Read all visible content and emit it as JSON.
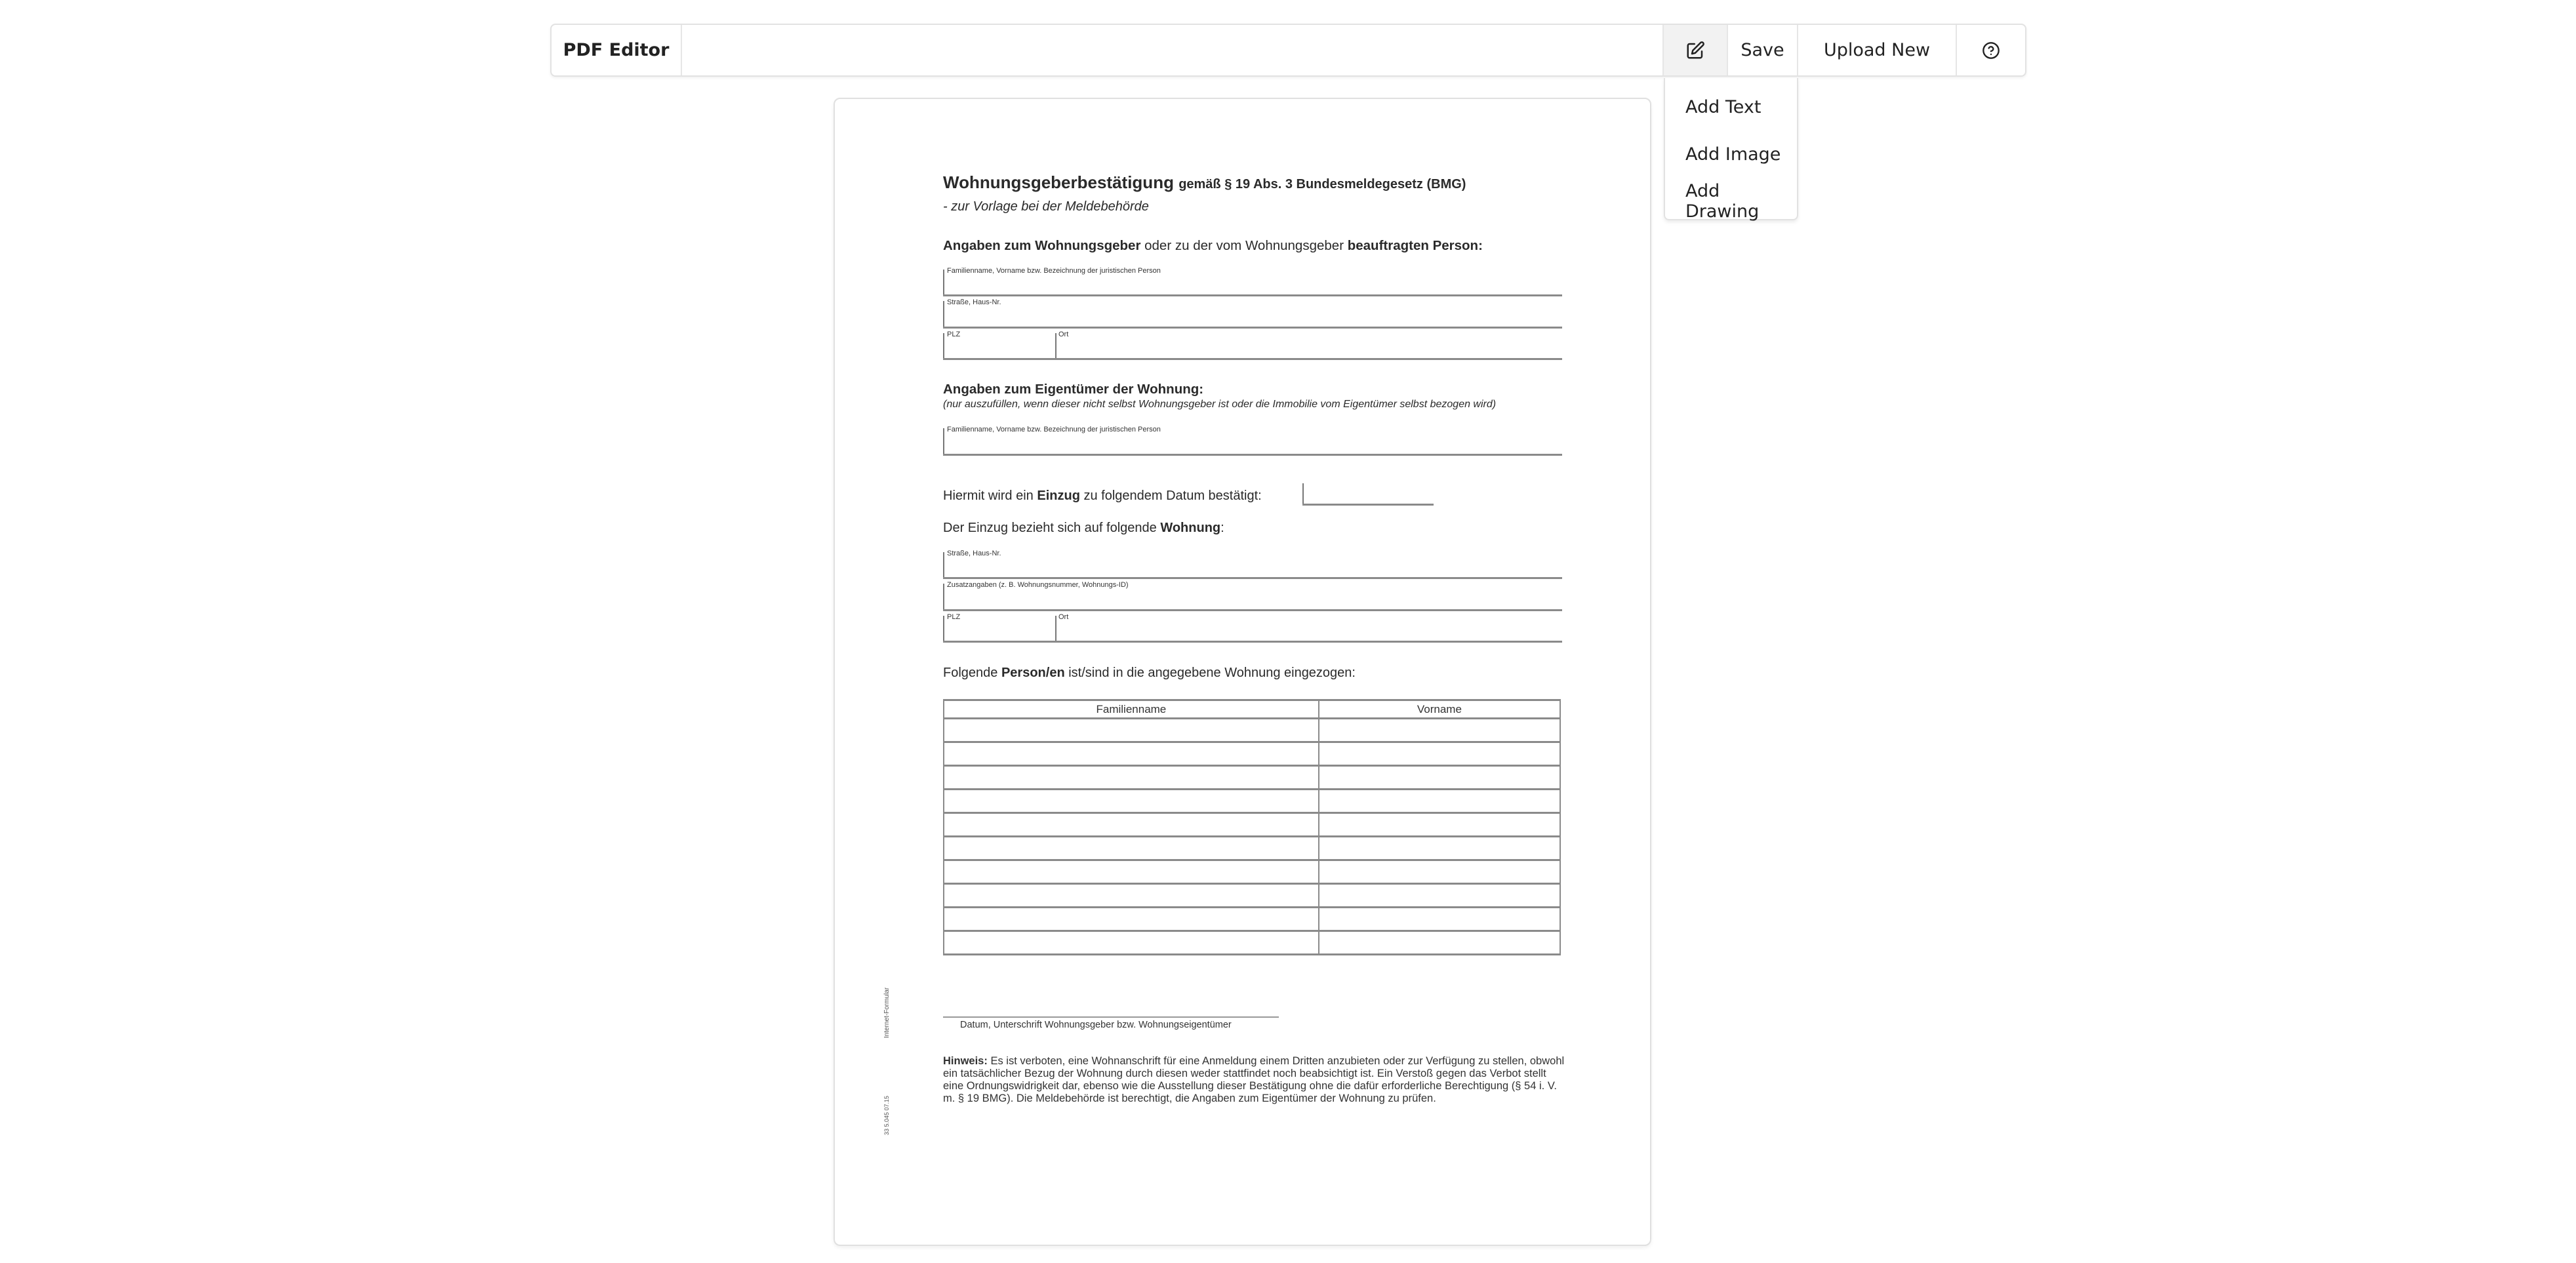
{
  "toolbar": {
    "brand": "PDF Editor",
    "edit_icon": "edit-icon",
    "save_label": "Save",
    "upload_label": "Upload New",
    "help_icon": "help-circle-icon"
  },
  "edit_menu": {
    "items": [
      {
        "label": "Add Text"
      },
      {
        "label": "Add Image"
      },
      {
        "label": "Add Drawing"
      }
    ]
  },
  "document": {
    "title_main": "Wohnungsgeberbestätigung",
    "title_sub": "gemäß § 19 Abs. 3 Bundesmeldegesetz (BMG)",
    "subtitle": "- zur Vorlage bei der Meldebehörde",
    "section1": {
      "heading_bold1": "Angaben zum Wohnungsgeber",
      "heading_normal": " oder zu der vom Wohnungsgeber ",
      "heading_bold2": "beauftragten Person:",
      "fields": {
        "name": "Familienname, Vorname bzw. Bezeichnung der juristischen Person",
        "street": "Straße, Haus-Nr.",
        "plz": "PLZ",
        "ort": "Ort"
      }
    },
    "section2": {
      "heading": "Angaben zum Eigentümer der Wohnung:",
      "note": "(nur auszufüllen, wenn dieser nicht selbst Wohnungsgeber ist oder die Immobilie vom Eigentümer selbst bezogen wird)",
      "fields": {
        "name": "Familienname, Vorname bzw. Bezeichnung der juristischen Person"
      }
    },
    "einzug": {
      "pre": "Hiermit wird ein ",
      "bold": "Einzug",
      "post": " zu folgendem Datum bestätigt:",
      "date_value": ""
    },
    "wohnung": {
      "pre": "Der Einzug bezieht sich auf folgende ",
      "bold": "Wohnung",
      "post": ":",
      "fields": {
        "street": "Straße, Haus-Nr.",
        "extra": "Zusatzangaben (z. B. Wohnungsnummer, Wohnungs-ID)",
        "plz": "PLZ",
        "ort": "Ort"
      }
    },
    "persons": {
      "pre": "Folgende ",
      "bold": "Person/en",
      "post": " ist/sind in die angegebene Wohnung eingezogen:",
      "columns": [
        "Familienname",
        "Vorname"
      ],
      "rows": [
        [
          "",
          ""
        ],
        [
          "",
          ""
        ],
        [
          "",
          ""
        ],
        [
          "",
          ""
        ],
        [
          "",
          ""
        ],
        [
          "",
          ""
        ],
        [
          "",
          ""
        ],
        [
          "",
          ""
        ],
        [
          "",
          ""
        ],
        [
          "",
          ""
        ]
      ]
    },
    "signature_label": "Datum, Unterschrift Wohnungsgeber bzw. Wohnungseigentümer",
    "hinweis_bold": "Hinweis:",
    "hinweis_text": " Es ist verboten, eine Wohnanschrift für eine Anmeldung einem Dritten anzubieten oder zur Verfügung zu stellen, obwohl ein tatsächlicher Bezug der Wohnung durch diesen weder stattfindet noch beabsichtigt ist. Ein Verstoß gegen das Verbot stellt eine Ordnungswidrigkeit dar, ebenso wie die Ausstellung dieser Bestätigung ohne die dafür erforderliche Berechtigung (§ 54 i. V. m. § 19 BMG). Die Meldebehörde ist berechtigt, die Angaben zum Eigentümer der Wohnung zu prüfen.",
    "side_label": "Internet-Formular",
    "side_code": "33 5.045 07.15"
  }
}
